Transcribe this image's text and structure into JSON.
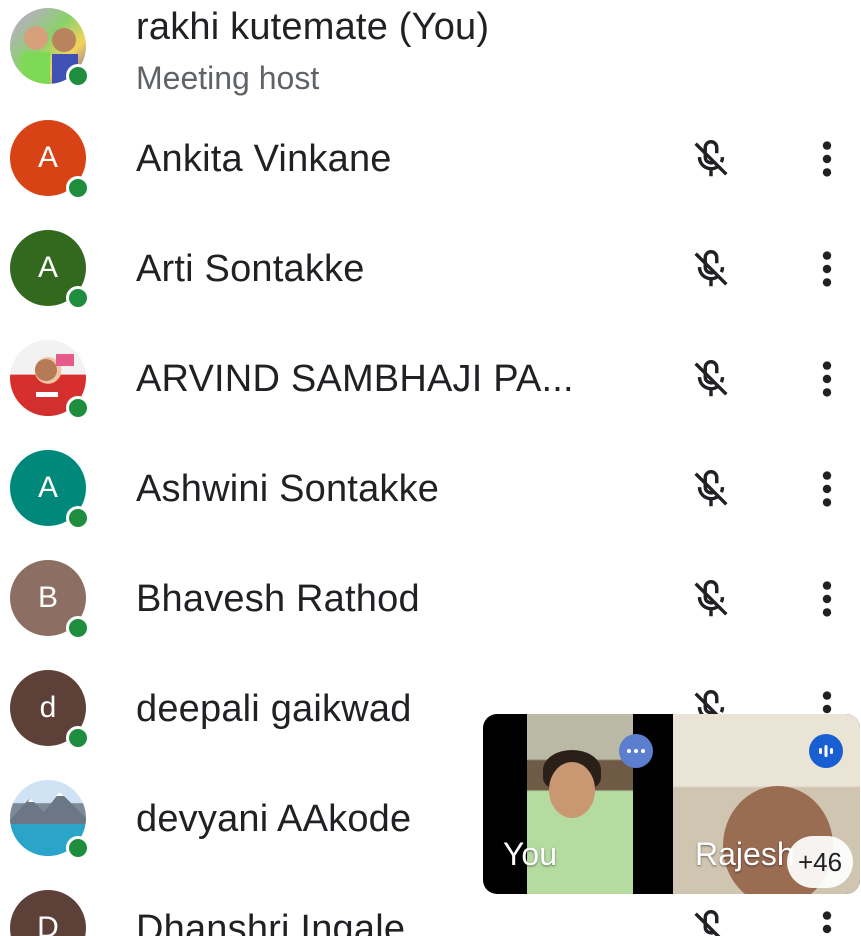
{
  "host": {
    "name": "rakhi kutemate (You)",
    "role": "Meeting host"
  },
  "participants": [
    {
      "name": "Ankita Vinkane",
      "initial": "A",
      "color": "#d84315"
    },
    {
      "name": "Arti Sontakke",
      "initial": "A",
      "color": "#33691e"
    },
    {
      "name": "ARVIND SAMBHAJI PA...",
      "initial": "",
      "color": ""
    },
    {
      "name": "Ashwini Sontakke",
      "initial": "A",
      "color": "#00897b"
    },
    {
      "name": "Bhavesh Rathod",
      "initial": "B",
      "color": "#8d6e63"
    },
    {
      "name": "deepali gaikwad",
      "initial": "d",
      "color": "#5d4037"
    },
    {
      "name": "devyani AAkode",
      "initial": "",
      "color": ""
    },
    {
      "name": "Dhanshri Ingale",
      "initial": "D",
      "color": "#5d4037"
    }
  ],
  "icons": {
    "mic": "mic-off-icon",
    "more": "more-vert-icon",
    "status": "online-dot"
  },
  "colors": {
    "online": "#1e8e3e",
    "name_text": "#202124",
    "sub_text": "#5f6368",
    "icon": "#202124"
  },
  "pip": {
    "you_label": "You",
    "other_label": "Rajesh",
    "more_count": "+46"
  }
}
